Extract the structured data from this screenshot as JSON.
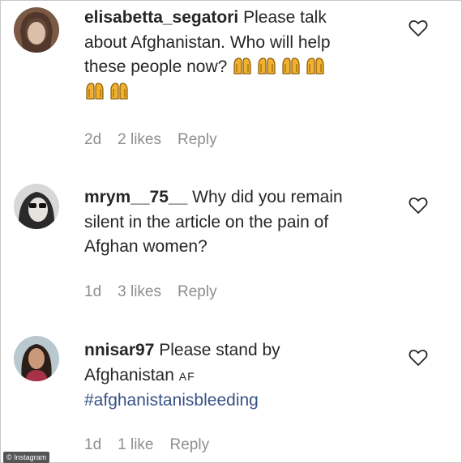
{
  "comments": [
    {
      "username": "elisabetta_segatori",
      "text_line1": "Please talk",
      "text_line2": "about Afghanistan. Who will help",
      "text_line3": "these people now?",
      "time": "2d",
      "likes": "2 likes",
      "reply": "Reply",
      "emoji_name": "praying-hands-icon"
    },
    {
      "username": "mrym__75__",
      "text_line1": "Why did you remain",
      "text_line2": "silent in the article on the pain of",
      "text_line3": "Afghan women?",
      "time": "1d",
      "likes": "3 likes",
      "reply": "Reply"
    },
    {
      "username": "nnisar97",
      "text_line1": "Please stand by",
      "text_line2": "Afghanistan",
      "flag": "AF",
      "hashtag": "#afghanistanisbleeding",
      "time": "1d",
      "likes": "1 like",
      "reply": "Reply"
    }
  ],
  "watermark": "© Instagram",
  "colors": {
    "text": "#262626",
    "meta": "#8e8e8e",
    "hashtag": "#385185",
    "emoji": "#e8a317"
  }
}
